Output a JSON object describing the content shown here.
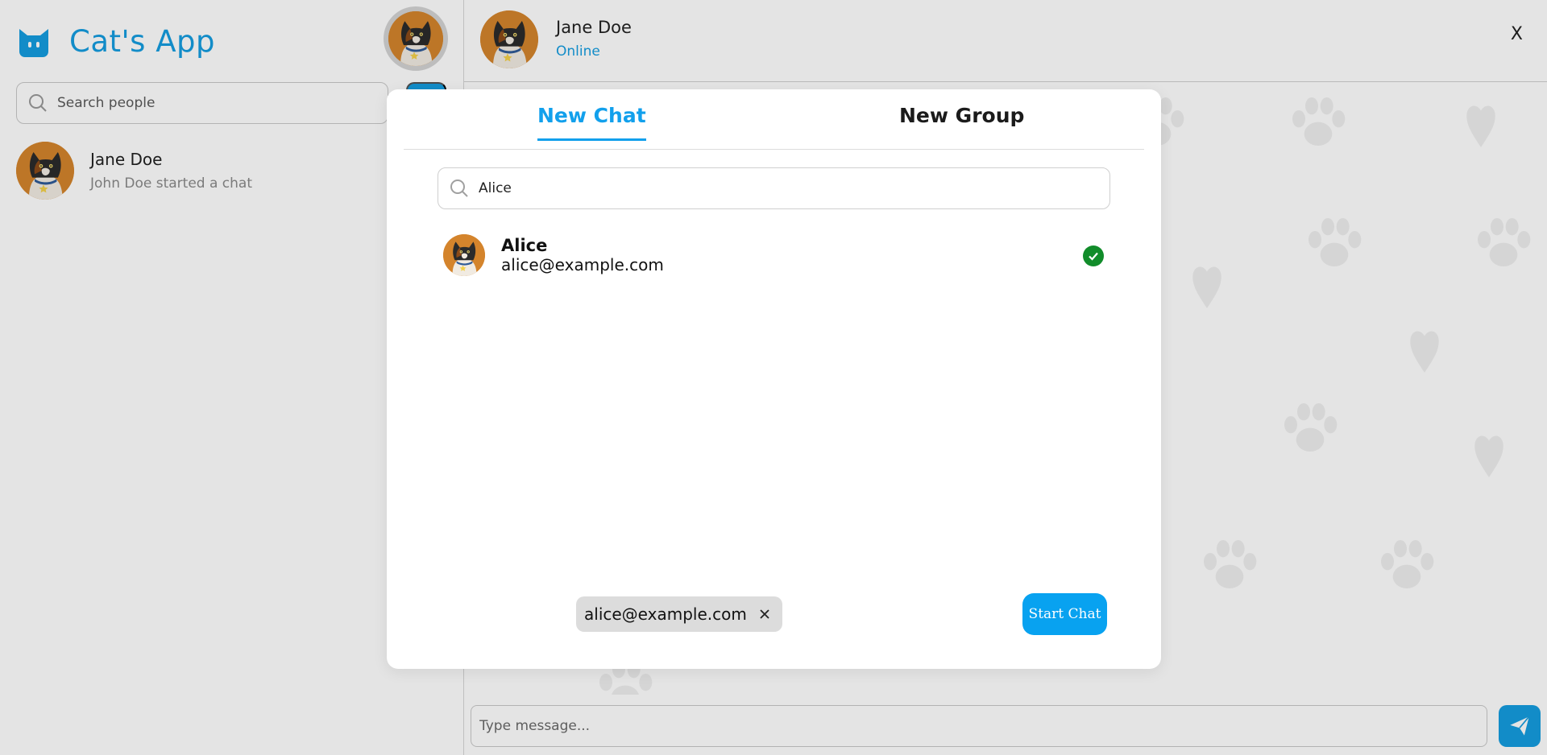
{
  "app": {
    "title": "Cat's App",
    "brand_color": "#159de0"
  },
  "sidebar": {
    "search_placeholder": "Search people",
    "chats": [
      {
        "name": "Jane Doe",
        "preview": "John Doe started a chat"
      }
    ]
  },
  "chat": {
    "contact_name": "Jane Doe",
    "status": "Online",
    "close_label": "X",
    "message_placeholder": "Type message..."
  },
  "modal": {
    "tabs": [
      {
        "label": "New Chat",
        "active": true
      },
      {
        "label": "New Group",
        "active": false
      }
    ],
    "search_value": "Alice",
    "results": [
      {
        "name": "Alice",
        "email": "alice@example.com",
        "selected": true
      }
    ],
    "selected_chips": [
      {
        "label": "alice@example.com"
      }
    ],
    "start_label": "Start Chat",
    "accent_color": "#12a0ec",
    "check_color": "#118c2a"
  }
}
